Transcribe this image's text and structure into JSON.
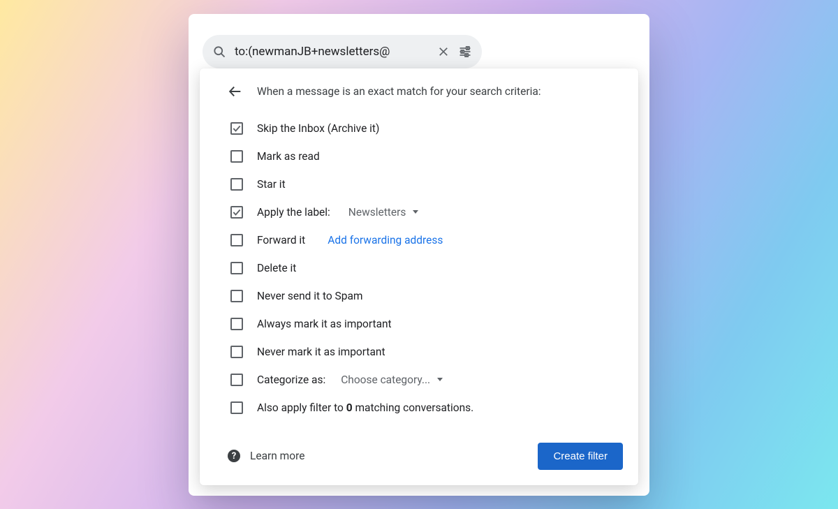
{
  "search": {
    "query": "to:(newmanJB+newsletters@"
  },
  "dialog": {
    "heading": "When a message is an exact match for your search criteria:",
    "options": {
      "skip_inbox": {
        "checked": true,
        "label": "Skip the Inbox (Archive it)"
      },
      "mark_read": {
        "checked": false,
        "label": "Mark as read"
      },
      "star": {
        "checked": false,
        "label": "Star it"
      },
      "apply_label": {
        "checked": true,
        "label": "Apply the label:",
        "value": "Newsletters"
      },
      "forward": {
        "checked": false,
        "label": "Forward it",
        "link": "Add forwarding address"
      },
      "delete": {
        "checked": false,
        "label": "Delete it"
      },
      "never_spam": {
        "checked": false,
        "label": "Never send it to Spam"
      },
      "always_important": {
        "checked": false,
        "label": "Always mark it as important"
      },
      "never_important": {
        "checked": false,
        "label": "Never mark it as important"
      },
      "categorize": {
        "checked": false,
        "label": "Categorize as:",
        "value": "Choose category..."
      },
      "also_apply": {
        "checked": false,
        "prefix": "Also apply filter to ",
        "count": "0",
        "suffix": " matching conversations."
      }
    },
    "learn_more": "Learn more",
    "submit": "Create filter"
  }
}
